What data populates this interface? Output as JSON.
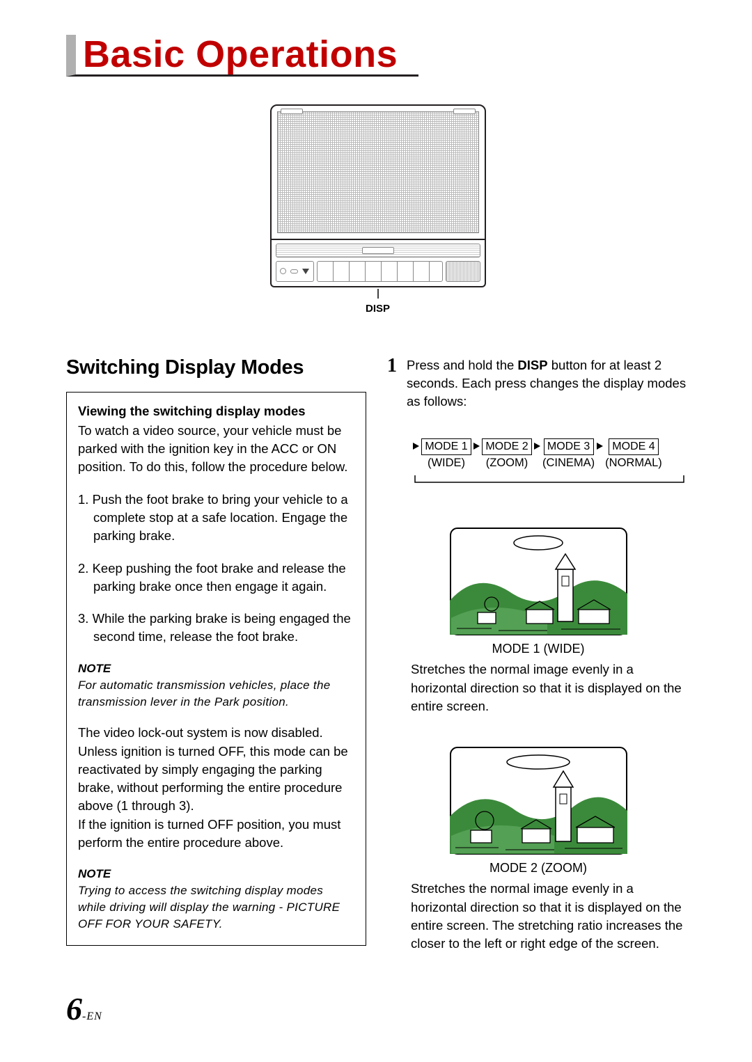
{
  "title": "Basic Operations",
  "device": {
    "callout": "DISP"
  },
  "left": {
    "heading": "Switching Display Modes",
    "sub": "Viewing the switching display modes",
    "intro": "To watch a video source, your vehicle must be parked with the ignition key in the ACC or ON position. To do this, follow the procedure below.",
    "steps": [
      "1. Push the foot brake to bring your vehicle to a complete stop at a safe location. Engage the parking brake.",
      "2. Keep pushing the foot brake and release the parking brake once then engage it again.",
      "3. While the parking brake is being engaged the second time, release the foot brake."
    ],
    "note1_label": "NOTE",
    "note1_text": "For automatic transmission vehicles, place the transmission lever in the Park position.",
    "para2a": "The video lock-out system is now disabled. Unless ignition is turned OFF, this mode can be reactivated by simply engaging the parking brake, without performing the entire procedure above (1 through 3).",
    "para2b": "If the ignition is turned OFF position, you must perform the entire procedure above.",
    "note2_label": "NOTE",
    "note2_text": "Trying to access the switching display modes while driving will display the warning - PICTURE OFF FOR YOUR SAFETY."
  },
  "right": {
    "step_num": "1",
    "step_pre": "Press and hold the ",
    "step_bold": "DISP",
    "step_post": " button for at least 2 seconds. Each press changes the display modes as follows:",
    "modes": [
      {
        "box": "MODE 1",
        "label": "(WIDE)"
      },
      {
        "box": "MODE 2",
        "label": "(ZOOM)"
      },
      {
        "box": "MODE 3",
        "label": "(CINEMA)"
      },
      {
        "box": "MODE 4",
        "label": "(NORMAL)"
      }
    ],
    "mode1_caption": "MODE 1 (WIDE)",
    "mode1_desc": "Stretches the normal image evenly in a horizontal direction so that it is displayed on the entire screen.",
    "mode2_caption": "MODE 2 (ZOOM)",
    "mode2_desc": "Stretches the normal image evenly in a horizontal direction so that it is displayed on the entire screen.  The stretching ratio increases the closer to the left or right edge of the screen."
  },
  "page": {
    "num": "6",
    "suffix": "-EN"
  }
}
